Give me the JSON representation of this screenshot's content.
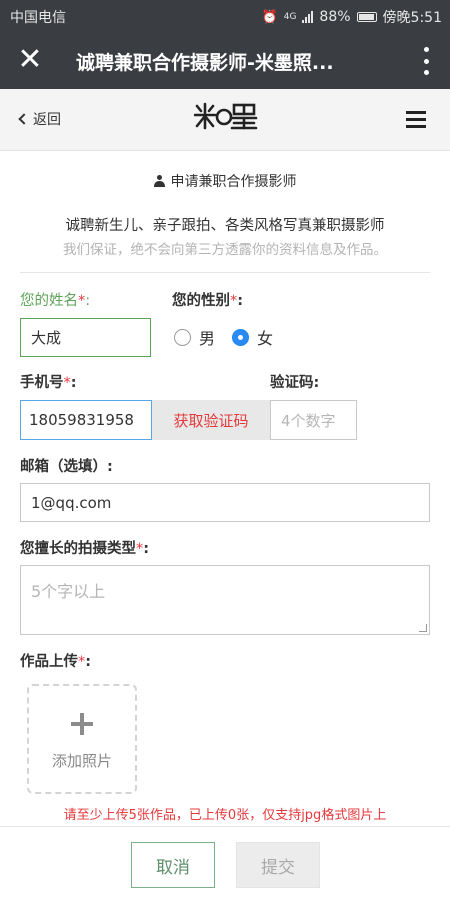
{
  "status_bar": {
    "carrier": "中国电信",
    "network": "4G",
    "battery": "88%",
    "time": "傍晚5:51"
  },
  "title_bar": {
    "title": "诚聘兼职合作摄影师-米墨照...",
    "close_icon": "close-icon",
    "more_icon": "more-vertical-icon"
  },
  "nav": {
    "back_label": "返回",
    "logo_text": "米墨",
    "menu_icon": "hamburger-icon"
  },
  "form": {
    "heading": "申请兼职合作摄影师",
    "intro_line1": "诚聘新生儿、亲子跟拍、各类风格写真兼职摄影师",
    "intro_line2": "我们保证，绝不会向第三方透露你的资料信息及作品。",
    "name": {
      "label": "您的姓名",
      "required_mark": "*",
      "colon": ":",
      "value": "大成"
    },
    "gender": {
      "label": "您的性别",
      "required_mark": "*",
      "colon": ":",
      "options": [
        "男",
        "女"
      ],
      "selected": "女"
    },
    "phone": {
      "label": "手机号",
      "required_mark": "*",
      "colon": ":",
      "value": "18059831958"
    },
    "get_code_button": "获取验证码",
    "code": {
      "label": "验证码:",
      "placeholder": "4个数字"
    },
    "email": {
      "label": "邮箱（选填）:",
      "value": "1@qq.com"
    },
    "photo_types": {
      "label": "您擅长的拍摄类型",
      "required_mark": "*",
      "colon": ":",
      "placeholder": "5个字以上"
    },
    "works_upload": {
      "label": "作品上传",
      "required_mark": "*",
      "colon": ":",
      "add_photo": "添加照片"
    },
    "warning": "请至少上传5张作品，已上传0张，仅支持jpg格式图片上"
  },
  "footer": {
    "cancel_label": "取消",
    "submit_label": "提交"
  },
  "colors": {
    "dark_bar": "#3a3d42",
    "error_red": "#e4393c",
    "focus_green": "#5ea35a",
    "focus_blue": "#5aa7e6",
    "radio_blue": "#2a8af6"
  }
}
